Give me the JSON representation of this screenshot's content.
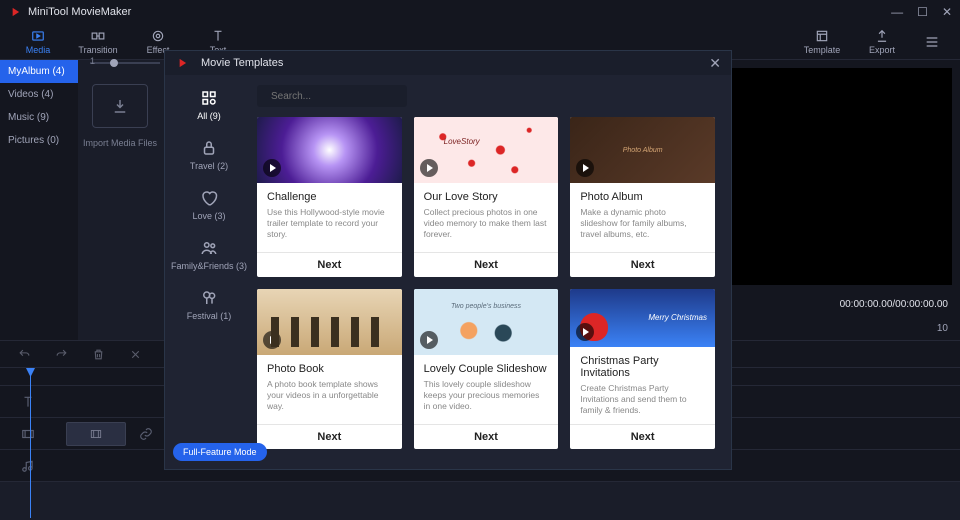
{
  "app": {
    "title": "MiniTool MovieMaker"
  },
  "toolbar": {
    "media": "Media",
    "transition": "Transition",
    "effect": "Effect",
    "text": "Text",
    "template": "Template",
    "export": "Export"
  },
  "sidebar": {
    "items": [
      {
        "label": "MyAlbum",
        "count": "(4)"
      },
      {
        "label": "Videos",
        "count": "(4)"
      },
      {
        "label": "Music",
        "count": "(9)"
      },
      {
        "label": "Pictures",
        "count": "(0)"
      }
    ]
  },
  "media_panel": {
    "import_label": "Import Media Files"
  },
  "preview": {
    "timecode": "00:00:00.00/00:00:00.00",
    "track_pos": "1",
    "track_total": "10"
  },
  "modal": {
    "title": "Movie Templates",
    "search_placeholder": "Search...",
    "categories": [
      {
        "label": "All",
        "count": "(9)"
      },
      {
        "label": "Travel",
        "count": "(2)"
      },
      {
        "label": "Love",
        "count": "(3)"
      },
      {
        "label": "Family&Friends",
        "count": "(3)"
      },
      {
        "label": "Festival",
        "count": "(1)"
      }
    ],
    "next_label": "Next",
    "templates": [
      {
        "title": "Challenge",
        "desc": "Use this Hollywood-style movie trailer template to record your story."
      },
      {
        "title": "Our Love Story",
        "desc": "Collect precious photos in one video memory to make them last forever.",
        "thumb_label": "LoveStory"
      },
      {
        "title": "Photo Album",
        "desc": "Make a dynamic photo slideshow for family albums, travel albums, etc."
      },
      {
        "title": "Photo Book",
        "desc": "A photo book template shows your videos in a unforgettable way."
      },
      {
        "title": "Lovely Couple Slideshow",
        "desc": "This lovely couple slideshow keeps your precious memories in one video.",
        "thumb_label": "Two people's business"
      },
      {
        "title": "Christmas Party Invitations",
        "desc": "Create Christmas Party Invitations and send them to family & friends.",
        "thumb_label": "Merry Christmas"
      }
    ],
    "full_feature": "Full-Feature Mode"
  }
}
